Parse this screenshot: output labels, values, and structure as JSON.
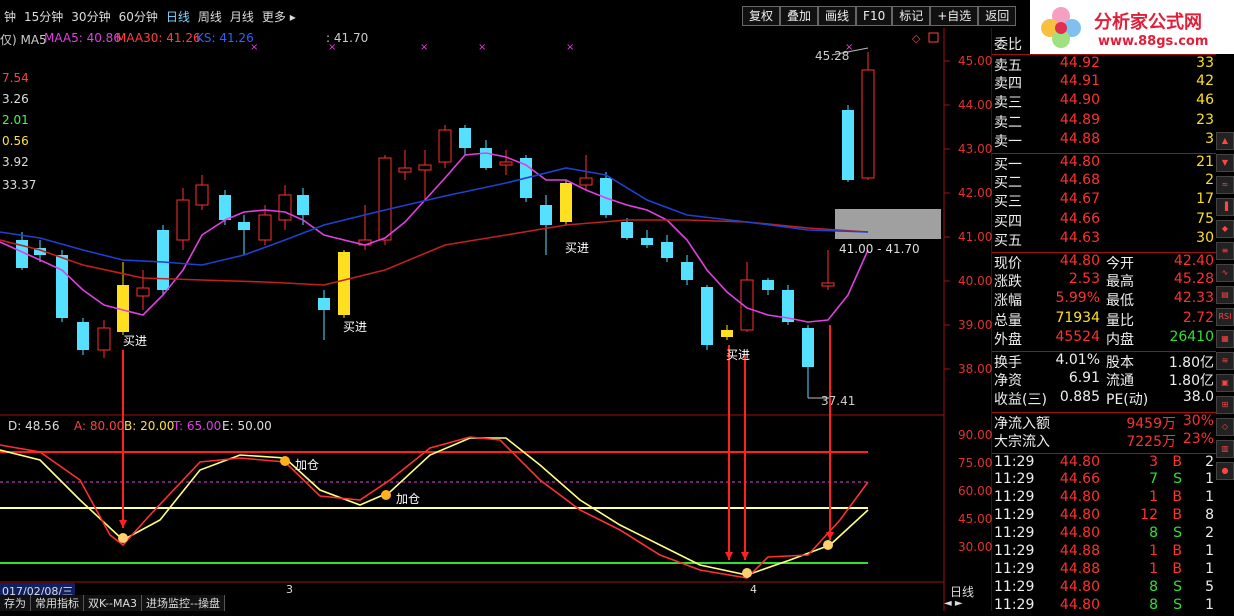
{
  "toolbar": {
    "periods": [
      "钟",
      "15分钟",
      "30分钟",
      "60分钟",
      "日线",
      "周线",
      "月线",
      "更多 ▸"
    ],
    "active_period": "日线",
    "buttons": [
      "复权",
      "叠加",
      "画线",
      "F10",
      "标记",
      "+自选",
      "返回"
    ]
  },
  "logo": {
    "title": "分析家公式网",
    "url": "www.88gs.com"
  },
  "indicators_top": {
    "ma5": "仅) MA5",
    "maa5": "MAA5: 40.86",
    "maa30": "MAA30: 41.26",
    "ks": "KS: 41.26",
    "extra": ": 41.70"
  },
  "left_values": [
    "7.54",
    "3.26",
    "2.01",
    "0.56",
    "3.92",
    "33.37"
  ],
  "price_axis": [
    "45.00",
    "44.00",
    "43.00",
    "42.00",
    "41.00",
    "40.00",
    "39.00",
    "38.00"
  ],
  "osc_axis": [
    "90.00",
    "75.00",
    "60.00",
    "45.00",
    "30.00"
  ],
  "annotations": {
    "high": "45.28",
    "low": "37.41",
    "range": "41.00 - 41.70",
    "buy": "买进",
    "add": "加仓"
  },
  "osc_legend": {
    "d": "D: 48.56",
    "a": "A: 80.00",
    "b": "B: 20.00",
    "t": "T: 65.00",
    "e": "E: 50.00"
  },
  "date_bar": {
    "date": "017/02/08/三",
    "m1": "3",
    "m2": "4",
    "period": "日线"
  },
  "bottom_tabs": [
    "存为",
    "常用指标",
    "双K--MA3",
    "进场监控--操盘"
  ],
  "panel": {
    "weibi": {
      "label": "委比"
    },
    "sells": [
      {
        "label": "卖五",
        "price": "44.92",
        "vol": "33"
      },
      {
        "label": "卖四",
        "price": "44.91",
        "vol": "42"
      },
      {
        "label": "卖三",
        "price": "44.90",
        "vol": "46"
      },
      {
        "label": "卖二",
        "price": "44.89",
        "vol": "23"
      },
      {
        "label": "卖一",
        "price": "44.88",
        "vol": "3"
      }
    ],
    "buys": [
      {
        "label": "买一",
        "price": "44.80",
        "vol": "21"
      },
      {
        "label": "买二",
        "price": "44.68",
        "vol": "2"
      },
      {
        "label": "买三",
        "price": "44.67",
        "vol": "17"
      },
      {
        "label": "买四",
        "price": "44.66",
        "vol": "75"
      },
      {
        "label": "买五",
        "price": "44.63",
        "vol": "30"
      }
    ],
    "stats": [
      {
        "l1": "现价",
        "v1": "44.80",
        "l2": "今开",
        "v2": "42.40"
      },
      {
        "l1": "涨跌",
        "v1": "2.53",
        "l2": "最高",
        "v2": "45.28"
      },
      {
        "l1": "涨幅",
        "v1": "5.99%",
        "l2": "最低",
        "v2": "42.33"
      },
      {
        "l1": "总量",
        "v1": "71934",
        "l2": "量比",
        "v2": "2.72"
      },
      {
        "l1": "外盘",
        "v1": "45524",
        "l2": "内盘",
        "v2": "26410"
      }
    ],
    "stats2": [
      {
        "l1": "换手",
        "v1": "4.01%",
        "l2": "股本",
        "v2": "1.80亿"
      },
      {
        "l1": "净资",
        "v1": "6.91",
        "l2": "流通",
        "v2": "1.80亿"
      },
      {
        "l1": "收益(三)",
        "v1": "0.885",
        "l2": "PE(动)",
        "v2": "38.0"
      }
    ],
    "flows": [
      {
        "label": "净流入额",
        "v": "9459万",
        "p": "30%"
      },
      {
        "label": "大宗流入",
        "v": "7225万",
        "p": "23%"
      }
    ],
    "trades": [
      {
        "t": "11:29",
        "p": "44.80",
        "v": "3",
        "s": "B",
        "n": "2"
      },
      {
        "t": "11:29",
        "p": "44.66",
        "v": "7",
        "s": "S",
        "n": "1"
      },
      {
        "t": "11:29",
        "p": "44.80",
        "v": "1",
        "s": "B",
        "n": "1"
      },
      {
        "t": "11:29",
        "p": "44.80",
        "v": "12",
        "s": "B",
        "n": "8"
      },
      {
        "t": "11:29",
        "p": "44.80",
        "v": "8",
        "s": "S",
        "n": "2"
      },
      {
        "t": "11:29",
        "p": "44.88",
        "v": "1",
        "s": "B",
        "n": "1"
      },
      {
        "t": "11:29",
        "p": "44.88",
        "v": "1",
        "s": "B",
        "n": "1"
      },
      {
        "t": "11:29",
        "p": "44.80",
        "v": "8",
        "s": "S",
        "n": "5"
      },
      {
        "t": "11:29",
        "p": "44.80",
        "v": "8",
        "s": "S",
        "n": "1"
      }
    ]
  },
  "side_icons": [
    "rsi-icon",
    "chart-icon"
  ],
  "colors": {
    "up": "#ff3030",
    "down": "#55e0ff",
    "buy_bar": "#ffe020",
    "maa5": "#e040e0",
    "maa30": "#c02020",
    "ks": "#2040d0"
  }
}
